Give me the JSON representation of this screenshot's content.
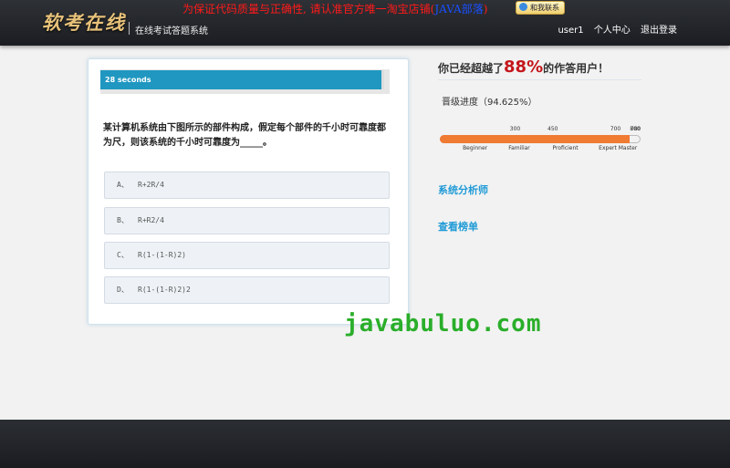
{
  "header": {
    "logo": "软考在线",
    "subtitle": "在线考试答题系统",
    "promo_text": "为保证代码质量与正确性, 请认准官方唯一淘宝店铺(",
    "promo_highlight": "JAVA部落",
    "promo_close": ")",
    "contact_label": "和我联系",
    "nav": {
      "user": "user1",
      "profile": "个人中心",
      "logout": "退出登录"
    }
  },
  "quiz": {
    "timer_text": "28 seconds",
    "timer_progress": 0.98,
    "question": "某计算机系统由下图所示的部件构成，假定每个部件的千小时可靠度都为尺，则该系统的千小时可靠度为_____。",
    "options": [
      {
        "letter": "A、",
        "text": "R+2R/4"
      },
      {
        "letter": "B、",
        "text": "R+R2/4"
      },
      {
        "letter": "C、",
        "text": "R(1-(1-R)2)"
      },
      {
        "letter": "D、",
        "text": "R(1-(1-R)2)2"
      }
    ]
  },
  "stats": {
    "beat_prefix": "你已经超越了",
    "beat_pct": "88%",
    "beat_suffix": "的作答用户！",
    "level_text": "晋级进度（94.625%）",
    "level_value": 757,
    "scale_max": 800,
    "ticks": [
      "300",
      "450",
      "700",
      "780",
      "800"
    ],
    "tick_values": [
      300,
      450,
      700,
      780,
      800
    ],
    "level_names": [
      "Beginner",
      "Familiar",
      "Proficient",
      "Expert",
      "Master"
    ],
    "level_positions": [
      130,
      350,
      580,
      750,
      880
    ],
    "fill_color": "#f07b33"
  },
  "links": {
    "category": "系统分析师",
    "leaderboard": "查看榜单"
  },
  "watermark": "javabuluo.com"
}
